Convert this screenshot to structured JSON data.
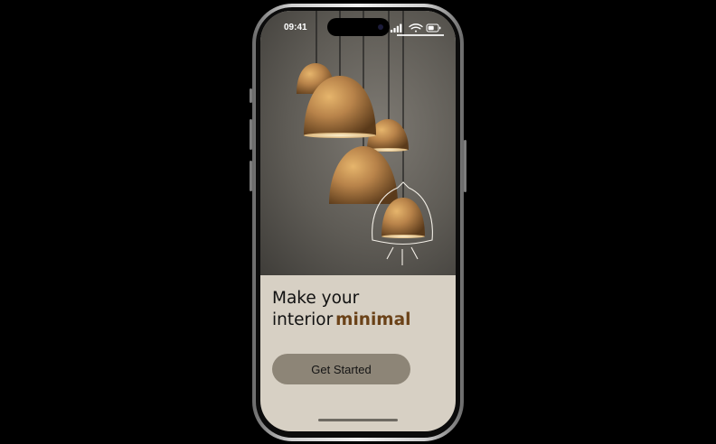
{
  "status_bar": {
    "time": "09:41",
    "icons": [
      "signal-icon",
      "wifi-icon",
      "battery-icon"
    ]
  },
  "hero": {
    "subject": "pendant-lamps-photo",
    "overlay_icon": "lamp-outline-icon"
  },
  "headline": {
    "line1": "Make your",
    "line2_prefix": "interior",
    "line2_accent": "minimal"
  },
  "cta": {
    "label": "Get Started"
  },
  "colors": {
    "background": "#000000",
    "panel": "#d7d0c4",
    "accent_text": "#6b4218",
    "button": "#8d8577"
  }
}
